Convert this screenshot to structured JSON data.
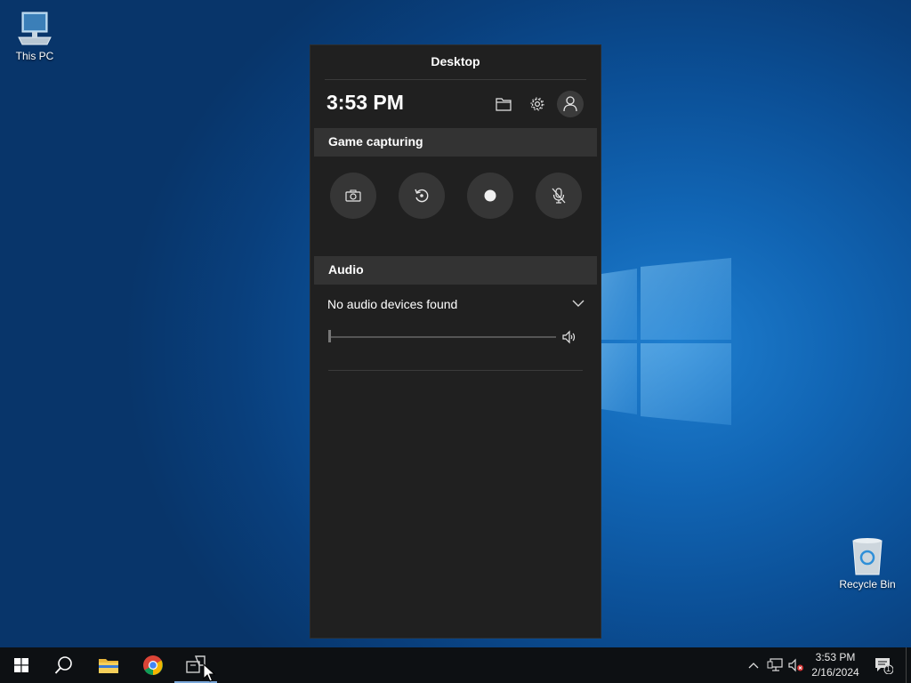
{
  "desktop": {
    "icons": [
      {
        "label": "This PC"
      },
      {
        "label": "Recycle Bin"
      }
    ]
  },
  "gamebar": {
    "title": "Desktop",
    "time": "3:53 PM",
    "sections": {
      "capture": {
        "label": "Game capturing"
      },
      "audio": {
        "label": "Audio",
        "device_text": "No audio devices found",
        "volume": 0
      }
    }
  },
  "taskbar": {
    "clock_time": "3:53 PM",
    "clock_date": "2/16/2024",
    "notification_count": "1"
  },
  "colors": {
    "panel_bg": "#202020",
    "section_bg": "#333333",
    "button_bg": "#363636",
    "taskbar_bg": "#0d1013"
  }
}
